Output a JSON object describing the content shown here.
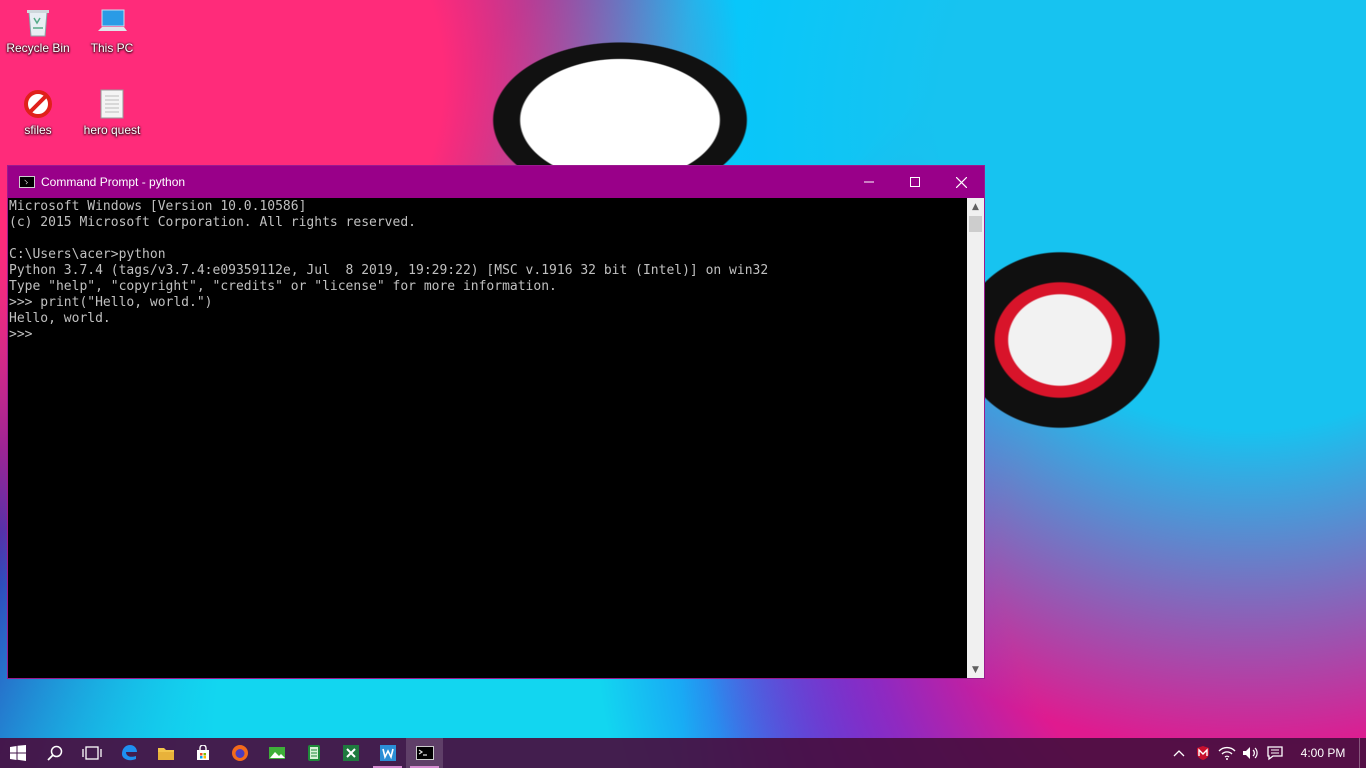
{
  "desktop": {
    "icons": [
      {
        "label": "Recycle Bin",
        "icon": "recycle-bin-icon"
      },
      {
        "label": "This PC",
        "icon": "computer-icon"
      },
      {
        "label": "sfiles",
        "icon": "blocked-icon"
      },
      {
        "label": "hero quest",
        "icon": "file-icon"
      }
    ]
  },
  "window": {
    "title": "Command Prompt - python",
    "controls": {
      "minimize": "—",
      "maximize": "☐",
      "close": "✕"
    },
    "console_lines": [
      "Microsoft Windows [Version 10.0.10586]",
      "(c) 2015 Microsoft Corporation. All rights reserved.",
      "",
      "C:\\Users\\acer>python",
      "Python 3.7.4 (tags/v3.7.4:e09359112e, Jul  8 2019, 19:29:22) [MSC v.1916 32 bit (Intel)] on win32",
      "Type \"help\", \"copyright\", \"credits\" or \"license\" for more information.",
      ">>> print(\"Hello, world.\")",
      "Hello, world.",
      ">>>"
    ]
  },
  "taskbar": {
    "apps": [
      {
        "name": "start-button",
        "icon": "windows-logo-icon"
      },
      {
        "name": "search-button",
        "icon": "search-icon"
      },
      {
        "name": "task-view-button",
        "icon": "task-view-icon"
      },
      {
        "name": "edge-button",
        "icon": "edge-icon"
      },
      {
        "name": "file-explorer-button",
        "icon": "folder-icon"
      },
      {
        "name": "store-button",
        "icon": "store-icon"
      },
      {
        "name": "firefox-button",
        "icon": "firefox-icon"
      },
      {
        "name": "photos-button",
        "icon": "photos-icon"
      },
      {
        "name": "notepad-button",
        "icon": "notepad-icon"
      },
      {
        "name": "excel-button",
        "icon": "excel-icon"
      },
      {
        "name": "word-button",
        "icon": "word-icon"
      },
      {
        "name": "command-prompt-button",
        "icon": "command-prompt-icon"
      }
    ],
    "tray": {
      "icons": [
        "show-hidden-icons-icon",
        "mcafee-icon",
        "wifi-icon",
        "volume-icon",
        "action-center-icon"
      ],
      "clock": "4:00 PM"
    }
  },
  "colors": {
    "titlebar": "#990089",
    "console_bg": "#000000",
    "console_text": "#c0c0c0",
    "taskbar": "#480e40"
  }
}
